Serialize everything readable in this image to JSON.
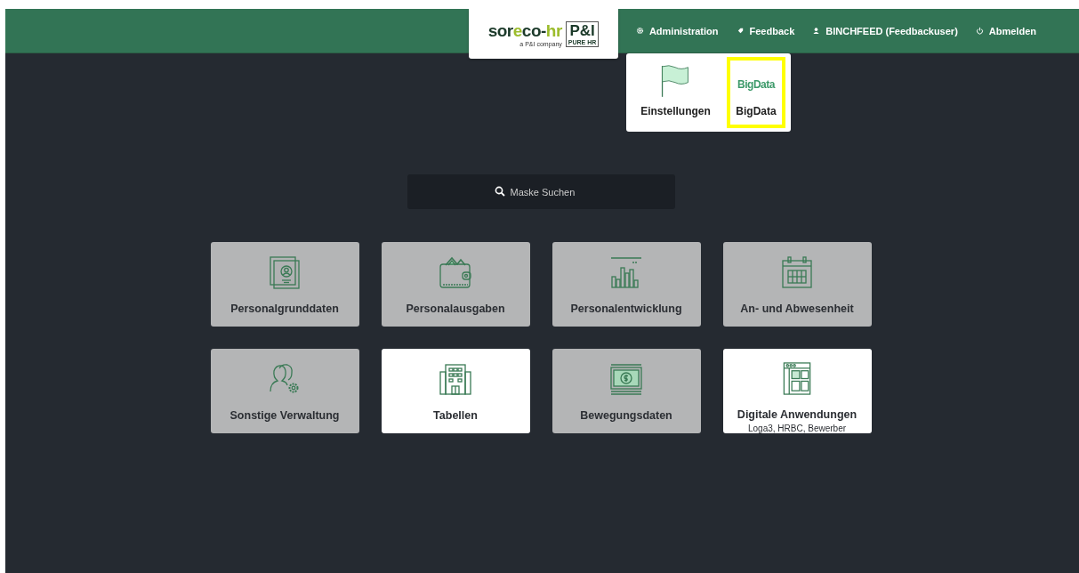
{
  "logo": {
    "brand_pre": "sor",
    "brand_accent": "e",
    "brand_post": "co-",
    "brand_tail": "hr",
    "tagline": "a P&I company",
    "badge": "P&I",
    "badge_sub": "PURE HR"
  },
  "nav": [
    {
      "kind": "gear",
      "label": "Administration",
      "menu": [
        {
          "kind": "flag",
          "label": "Einstellungen",
          "highlighted": false
        },
        {
          "kind": "bigdata",
          "logo_text": "BigData",
          "label": "BigData",
          "highlighted": true
        }
      ]
    },
    {
      "kind": "tag",
      "label": "Feedback"
    },
    {
      "kind": "user",
      "label": "BINCHFEED (Feedbackuser)"
    },
    {
      "kind": "power",
      "label": "Abmelden"
    }
  ],
  "search": {
    "placeholder": "Maske Suchen"
  },
  "tiles": [
    {
      "kind": "contact",
      "label": "Personalgrunddaten",
      "disabled": true
    },
    {
      "kind": "wallet",
      "label": "Personalausgaben",
      "disabled": true
    },
    {
      "kind": "chart",
      "label": "Personalentwicklung",
      "disabled": true
    },
    {
      "kind": "calendar",
      "label": "An- und Abwesenheit",
      "disabled": true
    },
    {
      "kind": "users",
      "label": "Sonstige Verwaltung",
      "disabled": true
    },
    {
      "kind": "building",
      "label": "Tabellen",
      "disabled": false
    },
    {
      "kind": "money",
      "label": "Bewegungsdaten",
      "disabled": true
    },
    {
      "kind": "app",
      "label": "Digitale Anwendungen",
      "sub": "Loga3, HRBC, Bewerber",
      "disabled": false
    }
  ]
}
